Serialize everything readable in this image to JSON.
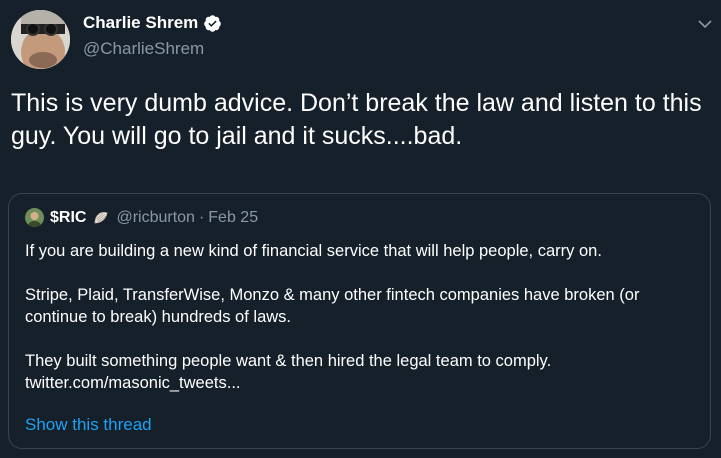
{
  "author": {
    "name": "Charlie Shrem",
    "handle": "@CharlieShrem",
    "verified": true,
    "avatar_icon": "profile-photo-glasses"
  },
  "tweet": {
    "text": "This is very dumb advice. Don’t break the law and listen to this guy. You will go to jail and it sucks....bad."
  },
  "quoted_tweet": {
    "name": "$RIC",
    "badge_icon": "seashell-icon",
    "handle": "@ricburton",
    "separator": "·",
    "date": "Feb 25",
    "paragraphs": [
      "If you are building a new kind of financial service that will help people, carry on.",
      "Stripe, Plaid, TransferWise, Monzo & many other fintech companies have broken (or continue to break) hundreds of laws.",
      "They built something people want & then hired the legal team to comply.",
      "twitter.com/masonic_tweets..."
    ],
    "show_thread_label": "Show this thread"
  },
  "colors": {
    "background": "#15202b",
    "text": "#ffffff",
    "secondary": "#8899a6",
    "link": "#1da1f2",
    "border": "#38444d"
  }
}
